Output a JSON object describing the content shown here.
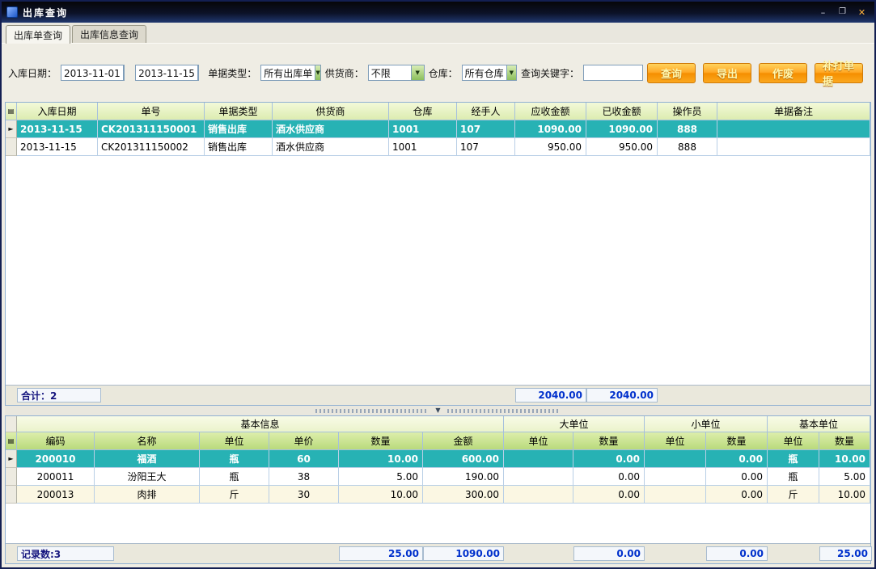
{
  "window": {
    "title": "出库查询"
  },
  "icons": {
    "minimize": "–",
    "maximize": "❐",
    "close": "✕",
    "dropdown_arrow": "▼",
    "row_pointer": "►",
    "grid_corner": "▤",
    "splitter_collapse": "▼"
  },
  "colors": {
    "selected_row_teal": "#27b2b4",
    "button_orange": "#f58f00",
    "total_number_blue": "#0030cc",
    "header_green": "#dcecb0"
  },
  "tabs": [
    {
      "label": "出库单查询"
    },
    {
      "label": "出库信息查询"
    }
  ],
  "filters": {
    "date_label": "入库日期：",
    "date_from": "2013-11-01",
    "date_to": "2013-11-15",
    "doc_type_label": "单据类型：",
    "doc_type": "所有出库单",
    "supplier_label": "供货商：",
    "supplier": "不限",
    "warehouse_label": "仓库：",
    "warehouse": "所有仓库",
    "keyword_label": "查询关键字：",
    "keyword_value": ""
  },
  "buttons": {
    "query": "查询",
    "export": "导出",
    "void": "作废",
    "reprint": "补打单据"
  },
  "main_table": {
    "headers": [
      "入库日期",
      "单号",
      "单据类型",
      "供货商",
      "仓库",
      "经手人",
      "应收金额",
      "已收金额",
      "操作员",
      "单据备注"
    ],
    "rows": [
      {
        "cells": [
          "2013-11-15",
          "CK201311150001",
          "销售出库",
          "酒水供应商",
          "1001",
          "107",
          "1090.00",
          "1090.00",
          "888",
          ""
        ]
      },
      {
        "cells": [
          "2013-11-15",
          "CK201311150002",
          "销售出库",
          "酒水供应商",
          "1001",
          "107",
          "950.00",
          "950.00",
          "888",
          ""
        ]
      }
    ],
    "footer": {
      "total_label": "合计：2",
      "receivable_total": "2040.00",
      "received_total": "2040.00"
    }
  },
  "detail_table": {
    "groups": [
      "基本信息",
      "大单位",
      "小单位",
      "基本单位"
    ],
    "headers": [
      "编码",
      "名称",
      "单位",
      "单价",
      "数量",
      "金额",
      "单位",
      "数量",
      "单位",
      "数量",
      "单位",
      "数量"
    ],
    "rows": [
      {
        "cells": [
          "200010",
          "福酒",
          "瓶",
          "60",
          "10.00",
          "600.00",
          "",
          "0.00",
          "",
          "0.00",
          "瓶",
          "10.00"
        ]
      },
      {
        "cells": [
          "200011",
          "汾阳王大",
          "瓶",
          "38",
          "5.00",
          "190.00",
          "",
          "0.00",
          "",
          "0.00",
          "瓶",
          "5.00"
        ]
      },
      {
        "cells": [
          "200013",
          "肉排",
          "斤",
          "30",
          "10.00",
          "300.00",
          "",
          "0.00",
          "",
          "0.00",
          "斤",
          "10.00"
        ]
      }
    ],
    "footer": {
      "count_label": "记录数:3",
      "qty_total": "25.00",
      "amount_total": "1090.00",
      "big_unit_qty_total": "0.00",
      "small_unit_qty_total": "0.00",
      "base_unit_qty_total": "25.00"
    }
  }
}
